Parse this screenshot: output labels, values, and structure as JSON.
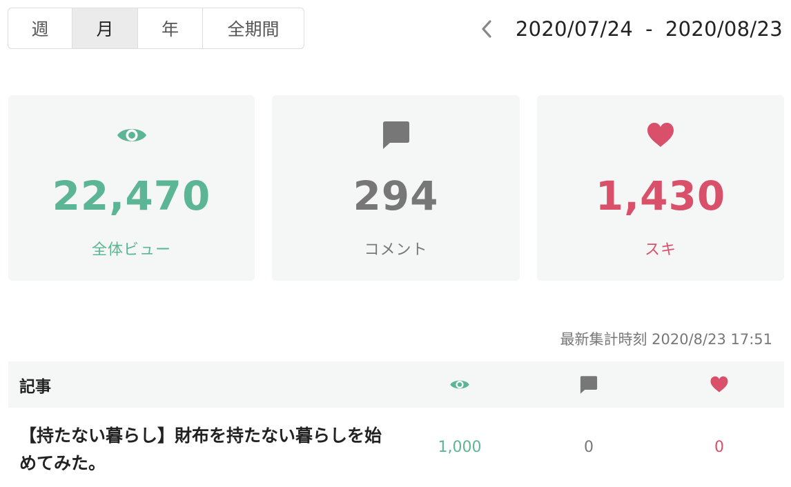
{
  "period_tabs": [
    "週",
    "月",
    "年",
    "全期間"
  ],
  "active_period": "月",
  "date_range": {
    "start": "2020/07/24",
    "separator": "-",
    "end": "2020/08/23",
    "prev_icon": "chevron-left-icon"
  },
  "stats": {
    "views": {
      "value": "22,470",
      "label": "全体ビュー",
      "icon": "eye-icon",
      "color": "#5cb594"
    },
    "comments": {
      "value": "294",
      "label": "コメント",
      "icon": "comment-icon",
      "color": "#777777"
    },
    "likes": {
      "value": "1,430",
      "label": "スキ",
      "icon": "heart-icon",
      "color": "#d9506a"
    }
  },
  "updated_at": "最新集計時刻 2020/8/23 17:51",
  "table": {
    "header_title": "記事",
    "header_icons": [
      "eye-icon",
      "comment-icon",
      "heart-icon"
    ],
    "rows": [
      {
        "title": "【持たない暮らし】財布を持たない暮らしを始めてみた。",
        "views": "1,000",
        "comments": "0",
        "likes": "0"
      }
    ]
  }
}
